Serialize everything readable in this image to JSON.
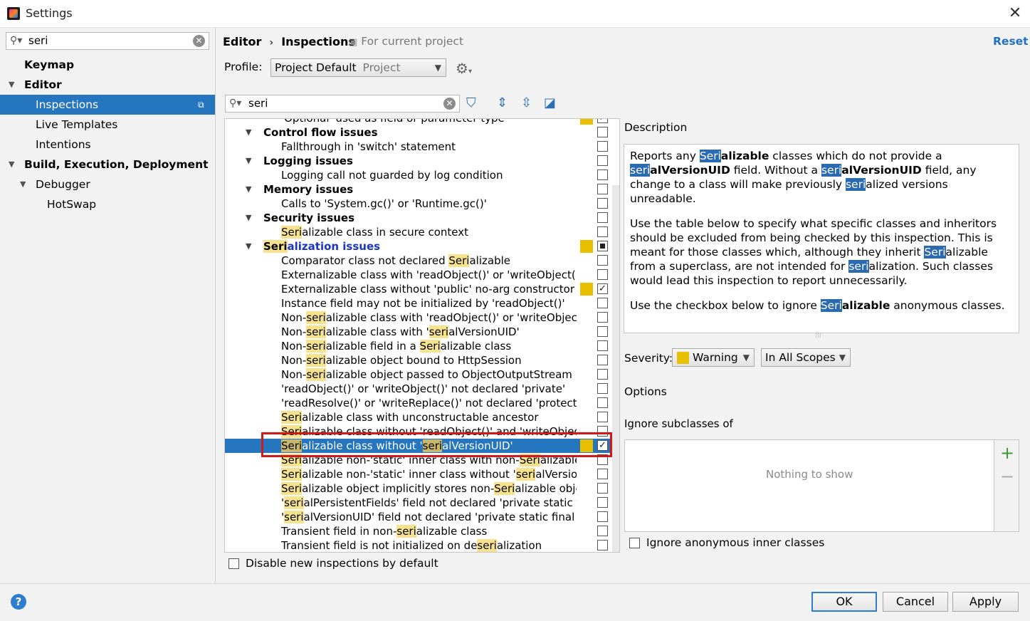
{
  "window": {
    "title": "Settings"
  },
  "sidebar": {
    "search_value": "seri",
    "items": [
      {
        "label": "Keymap",
        "level": 0,
        "bold": true,
        "arrow": ""
      },
      {
        "label": "Editor",
        "level": 0,
        "bold": true,
        "arrow": "▼"
      },
      {
        "label": "Inspections",
        "level": 1,
        "bold": false,
        "arrow": "",
        "selected": true
      },
      {
        "label": "Live Templates",
        "level": 1,
        "bold": false,
        "arrow": ""
      },
      {
        "label": "Intentions",
        "level": 1,
        "bold": false,
        "arrow": ""
      },
      {
        "label": "Build, Execution, Deployment",
        "level": 0,
        "bold": true,
        "arrow": "▼"
      },
      {
        "label": "Debugger",
        "level": 1,
        "bold": false,
        "arrow": "▼"
      },
      {
        "label": "HotSwap",
        "level": 2,
        "bold": false,
        "arrow": ""
      }
    ]
  },
  "header": {
    "breadcrumb_1": "Editor",
    "breadcrumb_sep": "›",
    "breadcrumb_2": "Inspections",
    "for_project": "For current project",
    "reset": "Reset",
    "profile_label": "Profile:",
    "profile_value": "Project Default",
    "profile_scope": "Project"
  },
  "inspection_filter": {
    "value": "seri"
  },
  "tree_rows": [
    {
      "type": "item",
      "text": "'Optional' used as field or parameter type",
      "sev": true,
      "check": "checked"
    },
    {
      "type": "cat",
      "text": "Control flow issues",
      "check": "none"
    },
    {
      "type": "item",
      "text": "Fallthrough in 'switch' statement",
      "check": "none"
    },
    {
      "type": "cat",
      "text": "Logging issues",
      "check": "none"
    },
    {
      "type": "item",
      "text": "Logging call not guarded by log condition",
      "check": "none"
    },
    {
      "type": "cat",
      "text": "Memory issues",
      "check": "none"
    },
    {
      "type": "item",
      "text": "Calls to 'System.gc()' or 'Runtime.gc()'",
      "check": "none"
    },
    {
      "type": "cat",
      "text": "Security issues",
      "check": "none"
    },
    {
      "type": "item",
      "text": "Serializable class in secure context",
      "check": "none"
    },
    {
      "type": "cat",
      "text": "Serialization issues",
      "sev": true,
      "check": "mixed",
      "blue": true
    },
    {
      "type": "item",
      "text": "Comparator class not declared Serializable",
      "check": "none"
    },
    {
      "type": "item",
      "text": "Externalizable class with 'readObject()' or 'writeObject()'",
      "check": "none"
    },
    {
      "type": "item",
      "text": "Externalizable class without 'public' no-arg constructor",
      "sev": true,
      "check": "checked"
    },
    {
      "type": "item",
      "text": "Instance field may not be initialized by 'readObject()'",
      "check": "none"
    },
    {
      "type": "item",
      "text": "Non-serializable class with 'readObject()' or 'writeObject()'",
      "check": "none"
    },
    {
      "type": "item",
      "text": "Non-serializable class with 'serialVersionUID'",
      "check": "none"
    },
    {
      "type": "item",
      "text": "Non-serializable field in a Serializable class",
      "check": "none"
    },
    {
      "type": "item",
      "text": "Non-serializable object bound to HttpSession",
      "check": "none"
    },
    {
      "type": "item",
      "text": "Non-serializable object passed to ObjectOutputStream",
      "check": "none"
    },
    {
      "type": "item",
      "text": "'readObject()' or 'writeObject()' not declared 'private'",
      "check": "none"
    },
    {
      "type": "item",
      "text": "'readResolve()' or 'writeReplace()' not declared 'protected'",
      "check": "none"
    },
    {
      "type": "item",
      "text": "Serializable class with unconstructable ancestor",
      "check": "none"
    },
    {
      "type": "item",
      "text": "Serializable class without 'readObject()' and 'writeObject()'",
      "check": "none"
    },
    {
      "type": "item",
      "text": "Serializable class without 'serialVersionUID'",
      "sev": true,
      "check": "checked",
      "selected": true
    },
    {
      "type": "item",
      "text": "Serializable non-'static' inner class with non-Serializable outer class",
      "check": "none"
    },
    {
      "type": "item",
      "text": "Serializable non-'static' inner class without 'serialVersionUID'",
      "check": "none"
    },
    {
      "type": "item",
      "text": "Serializable object implicitly stores non-Serializable object",
      "check": "none"
    },
    {
      "type": "item",
      "text": "'serialPersistentFields' field not declared 'private static final'",
      "check": "none"
    },
    {
      "type": "item",
      "text": "'serialVersionUID' field not declared 'private static final long'",
      "check": "none"
    },
    {
      "type": "item",
      "text": "Transient field in non-serializable class",
      "check": "none"
    },
    {
      "type": "item",
      "text": "Transient field is not initialized on deserialization",
      "check": "none"
    }
  ],
  "disable_new": "Disable new inspections by default",
  "description": {
    "title": "Description",
    "p1": [
      {
        "t": "Reports any "
      },
      {
        "t": "Seri",
        "k": "sk"
      },
      {
        "t": "alizable",
        "b": true
      },
      {
        "t": " classes which do not provide a "
      },
      {
        "t": "seri",
        "k": "sk"
      },
      {
        "t": "alVersionUID",
        "b": true
      },
      {
        "t": " field. Without a "
      },
      {
        "t": "seri",
        "k": "sk"
      },
      {
        "t": "alVersionUID",
        "b": true
      },
      {
        "t": " field, any change to a class will make previously "
      },
      {
        "t": "seri",
        "k": "sk"
      },
      {
        "t": "alized versions unreadable."
      }
    ],
    "p2": [
      {
        "t": "Use the table below to specify what specific classes and inheritors should be excluded from being checked by this inspection. This is meant for those classes which, although they inherit "
      },
      {
        "t": "Seri",
        "k": "sk"
      },
      {
        "t": "alizable from a superclass, are not intended for "
      },
      {
        "t": "seri",
        "k": "sk"
      },
      {
        "t": "alization. Such classes would lead this inspection to report unnecessarily."
      }
    ],
    "p3": [
      {
        "t": "Use the checkbox below to ignore "
      },
      {
        "t": "Seri",
        "k": "sk"
      },
      {
        "t": "alizable",
        "b": true
      },
      {
        "t": " anonymous classes."
      }
    ]
  },
  "severity": {
    "label": "Severity:",
    "value": "Warning",
    "scope": "In All Scopes",
    "color": "#e8c000"
  },
  "options": {
    "label": "Options",
    "ignore_subclasses": "Ignore subclasses of",
    "empty_text": "Nothing to show",
    "ignore_anonymous": "Ignore anonymous inner classes"
  },
  "footer": {
    "help": "?",
    "ok": "OK",
    "cancel": "Cancel",
    "apply": "Apply"
  }
}
